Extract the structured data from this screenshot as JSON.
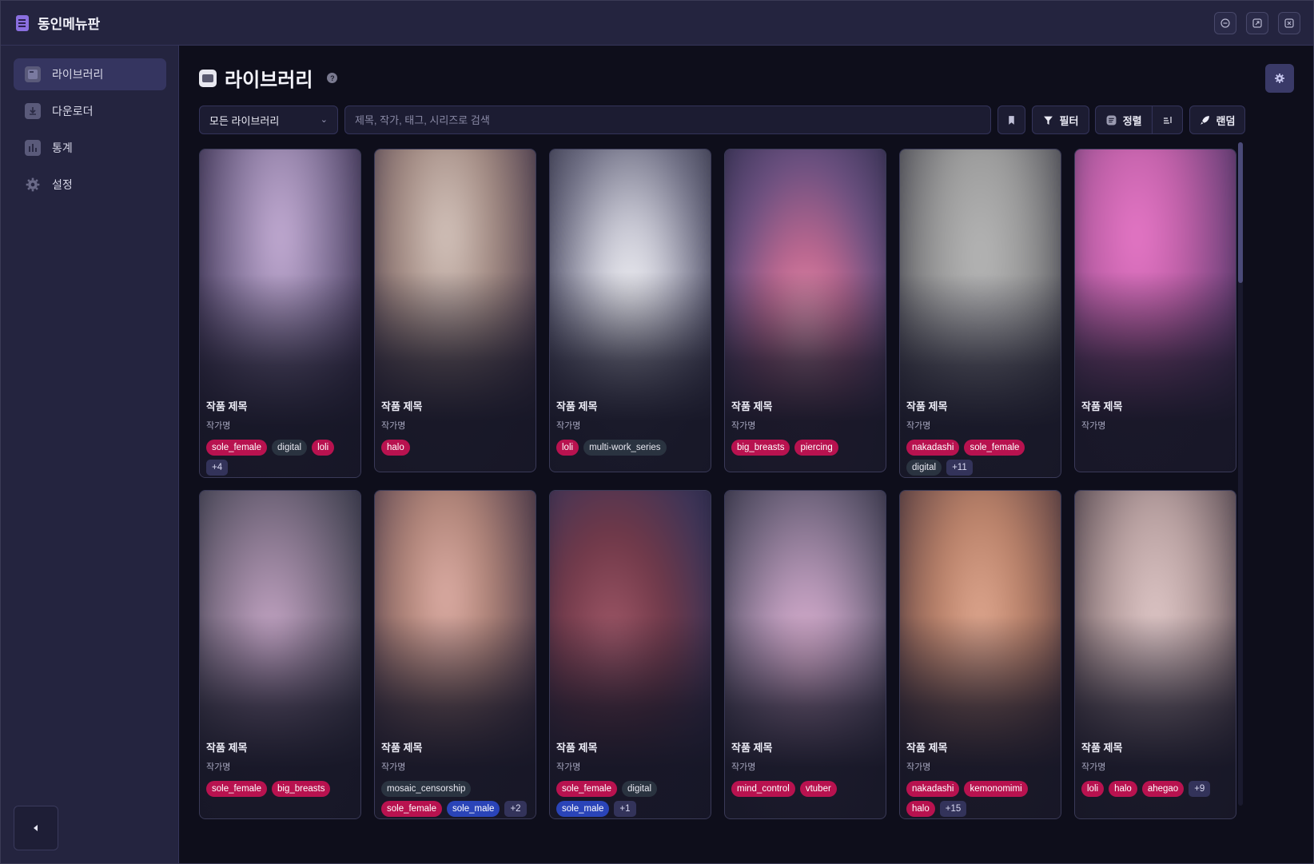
{
  "app": {
    "title": "동인메뉴판",
    "icon": "book-icon"
  },
  "window_controls": [
    {
      "name": "minimize-button",
      "icon": "minus-icon"
    },
    {
      "name": "maximize-button",
      "icon": "expand-icon"
    },
    {
      "name": "close-button",
      "icon": "close-icon"
    }
  ],
  "sidebar": {
    "items": [
      {
        "label": "라이브러리",
        "icon": "library-icon",
        "active": true
      },
      {
        "label": "다운로더",
        "icon": "download-icon",
        "active": false
      },
      {
        "label": "통계",
        "icon": "chart-icon",
        "active": false
      },
      {
        "label": "설정",
        "icon": "gear-icon",
        "active": false
      }
    ],
    "collapse_icon": "chevron-left-icon"
  },
  "header": {
    "title": "라이브러리",
    "help": "?"
  },
  "toolbar": {
    "library_select": "모든 라이브러리",
    "search_placeholder": "제목, 작가, 태그, 시리즈로 검색",
    "filter_label": "필터",
    "sort_label": "정렬",
    "random_label": "랜덤"
  },
  "colors": {
    "accent": "#b8124f",
    "background": "#0e0e1b",
    "sidebar": "#24243f",
    "tag_blue": "#2a44b8"
  },
  "cards": [
    {
      "title": "작품 제목",
      "author": "작가명",
      "tags": [
        {
          "t": "sole_female",
          "c": "pink"
        },
        {
          "t": "digital",
          "c": "gray"
        },
        {
          "t": "loli",
          "c": "pink"
        },
        {
          "t": "+4",
          "c": "more"
        }
      ]
    },
    {
      "title": "작품 제목",
      "author": "작가명",
      "tags": [
        {
          "t": "halo",
          "c": "pink"
        }
      ]
    },
    {
      "title": "작품 제목",
      "author": "작가명",
      "tags": [
        {
          "t": "loli",
          "c": "pink"
        },
        {
          "t": "multi-work_series",
          "c": "gray"
        }
      ]
    },
    {
      "title": "작품 제목",
      "author": "작가명",
      "tags": [
        {
          "t": "big_breasts",
          "c": "pink"
        },
        {
          "t": "piercing",
          "c": "pink"
        }
      ]
    },
    {
      "title": "작품 제목",
      "author": "작가명",
      "tags": [
        {
          "t": "nakadashi",
          "c": "pink"
        },
        {
          "t": "sole_female",
          "c": "pink"
        },
        {
          "t": "digital",
          "c": "gray"
        },
        {
          "t": "+11",
          "c": "more"
        }
      ]
    },
    {
      "title": "작품 제목",
      "author": "작가명",
      "tags": []
    },
    {
      "title": "작품 제목",
      "author": "작가명",
      "tags": [
        {
          "t": "sole_female",
          "c": "pink"
        },
        {
          "t": "big_breasts",
          "c": "pink"
        }
      ]
    },
    {
      "title": "작품 제목",
      "author": "작가명",
      "tags": [
        {
          "t": "mosaic_censorship",
          "c": "gray"
        },
        {
          "t": "sole_female",
          "c": "pink"
        },
        {
          "t": "sole_male",
          "c": "blue"
        },
        {
          "t": "+2",
          "c": "more"
        }
      ]
    },
    {
      "title": "작품 제목",
      "author": "작가명",
      "tags": [
        {
          "t": "sole_female",
          "c": "pink"
        },
        {
          "t": "digital",
          "c": "gray"
        },
        {
          "t": "sole_male",
          "c": "blue"
        },
        {
          "t": "+1",
          "c": "more"
        }
      ]
    },
    {
      "title": "작품 제목",
      "author": "작가명",
      "tags": [
        {
          "t": "mind_control",
          "c": "pink"
        },
        {
          "t": "vtuber",
          "c": "pink"
        }
      ]
    },
    {
      "title": "작품 제목",
      "author": "작가명",
      "tags": [
        {
          "t": "nakadashi",
          "c": "pink"
        },
        {
          "t": "kemonomimi",
          "c": "pink"
        },
        {
          "t": "halo",
          "c": "pink"
        },
        {
          "t": "+15",
          "c": "more"
        }
      ]
    },
    {
      "title": "작품 제목",
      "author": "작가명",
      "tags": [
        {
          "t": "loli",
          "c": "pink"
        },
        {
          "t": "halo",
          "c": "pink"
        },
        {
          "t": "ahegao",
          "c": "pink"
        },
        {
          "t": "+9",
          "c": "more"
        }
      ]
    }
  ]
}
